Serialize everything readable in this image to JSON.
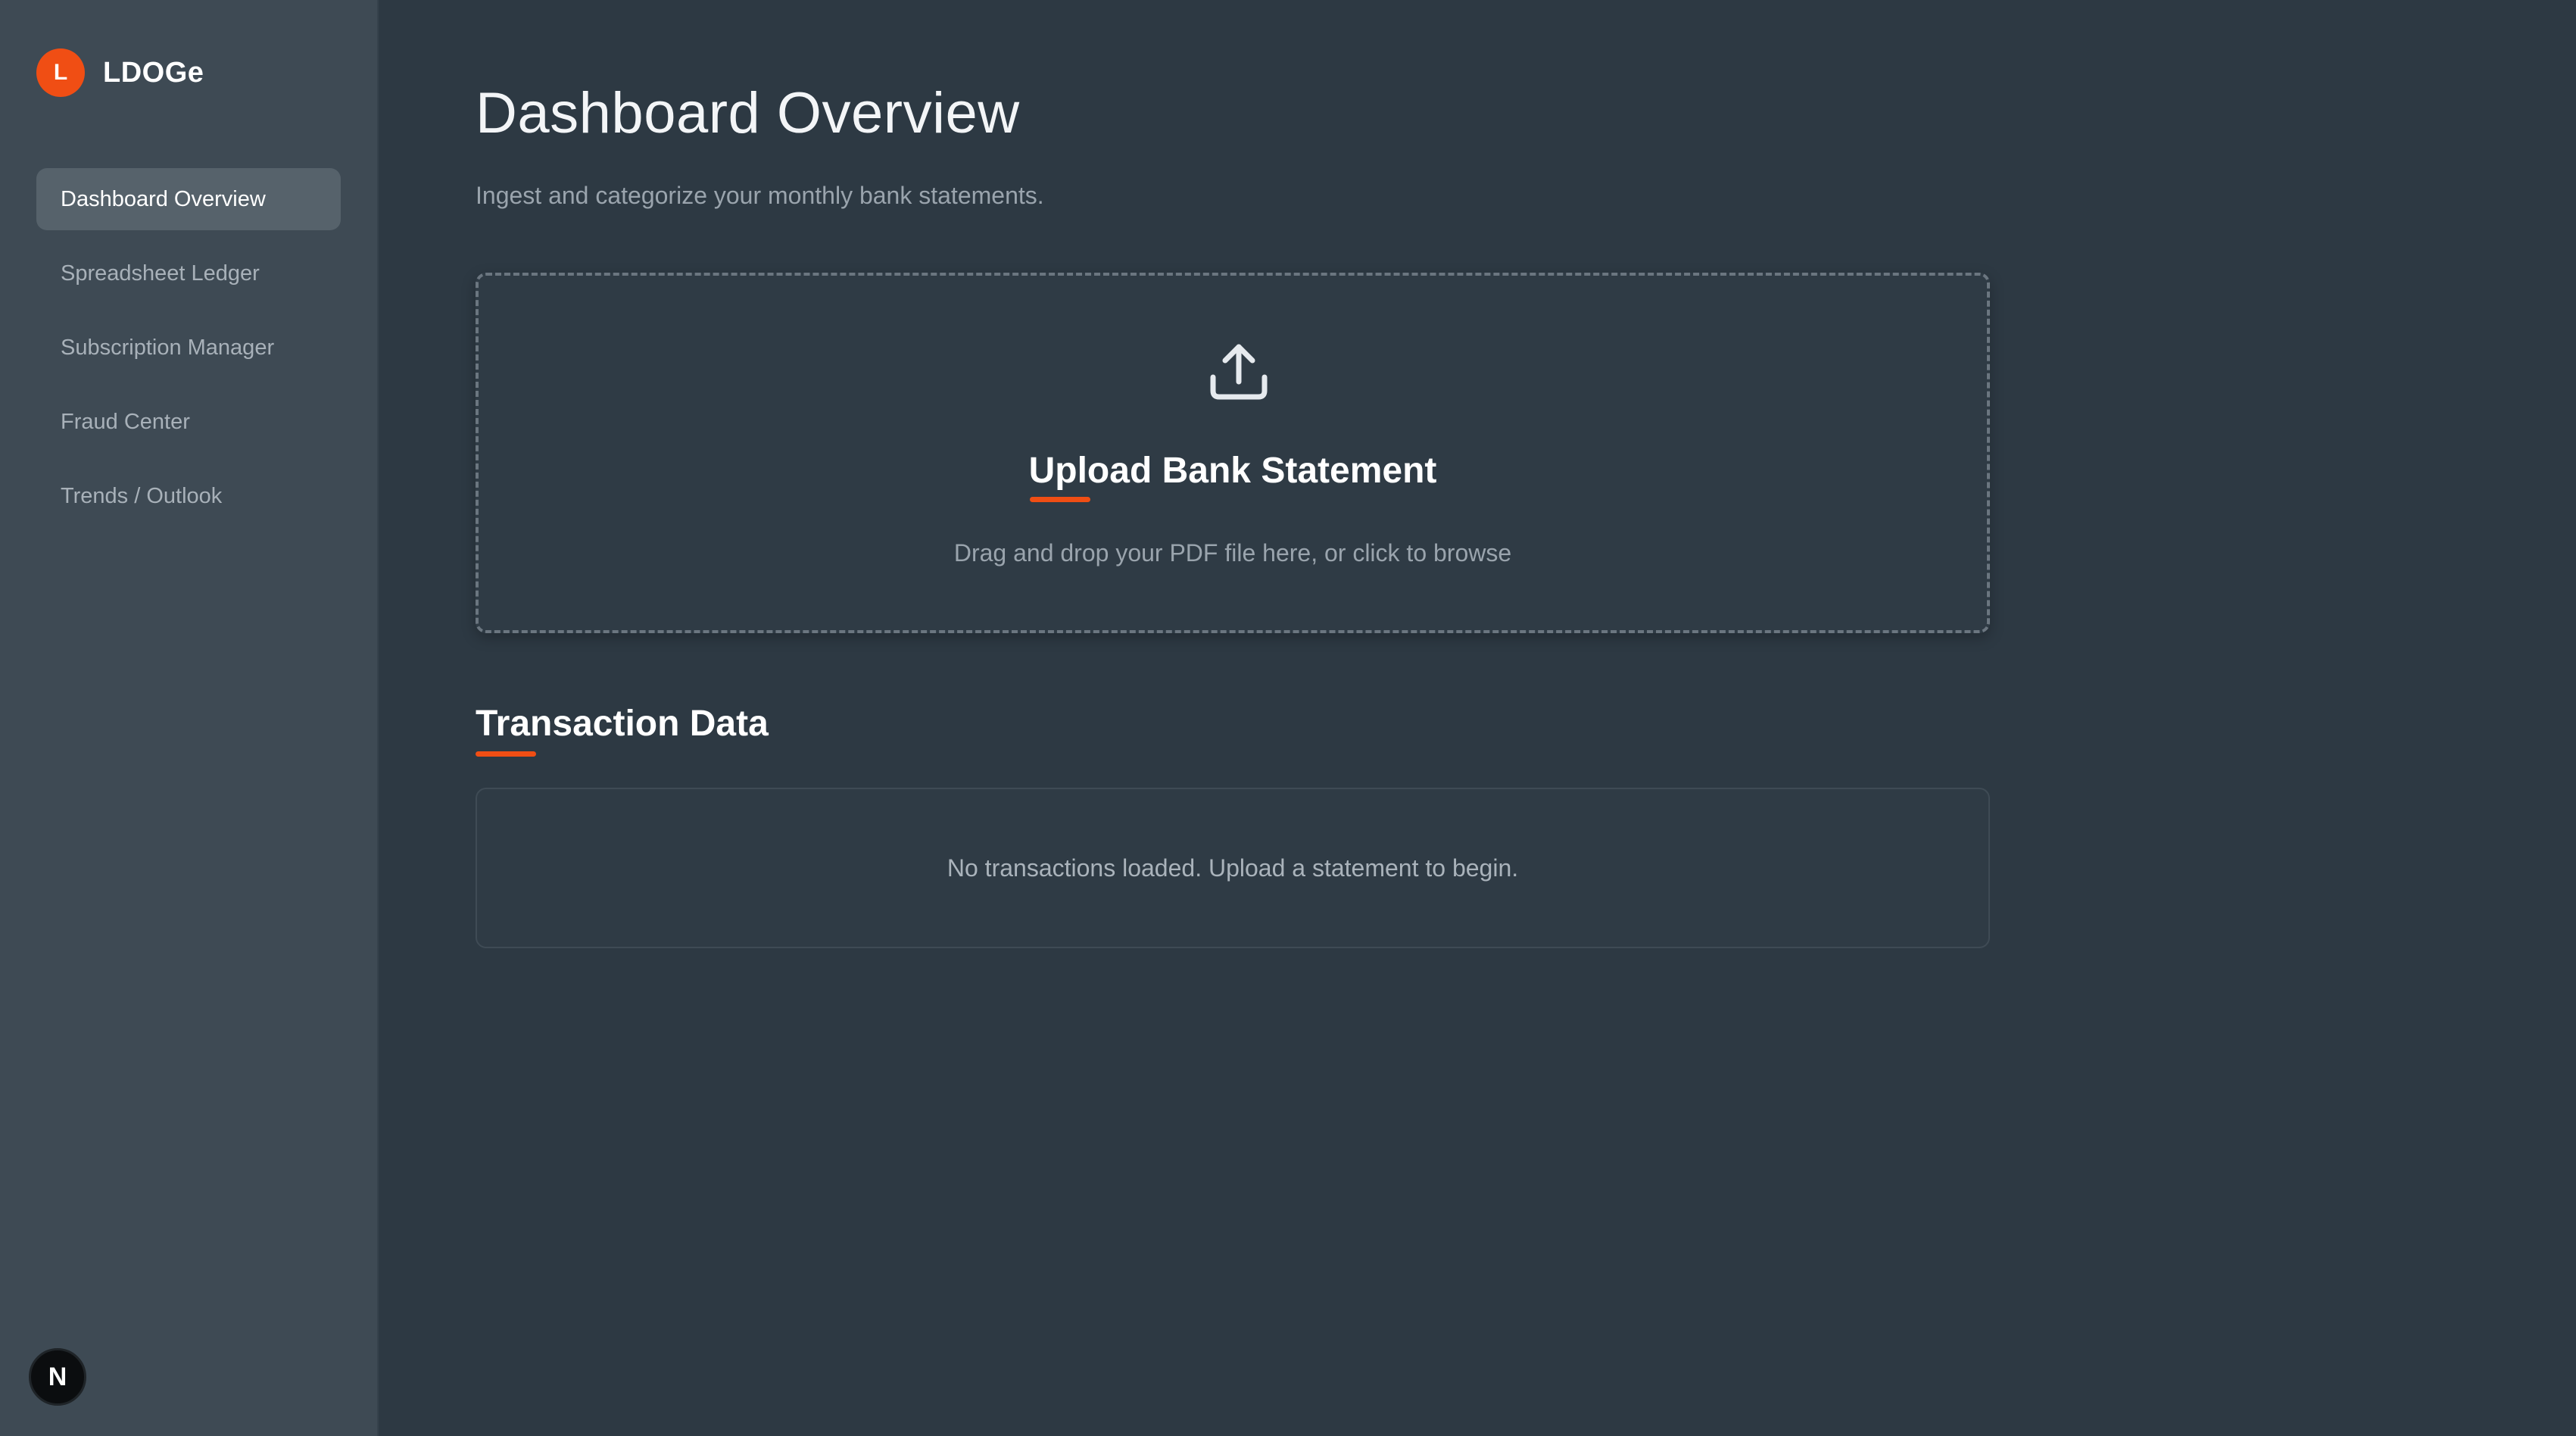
{
  "brand": {
    "logo_letter": "L",
    "name": "LDOGe"
  },
  "sidebar": {
    "items": [
      {
        "label": "Dashboard Overview",
        "active": true
      },
      {
        "label": "Spreadsheet Ledger",
        "active": false
      },
      {
        "label": "Subscription Manager",
        "active": false
      },
      {
        "label": "Fraud Center",
        "active": false
      },
      {
        "label": "Trends / Outlook",
        "active": false
      }
    ],
    "user_badge": "N"
  },
  "header": {
    "title": "Dashboard Overview",
    "subtitle": "Ingest and categorize your monthly bank statements."
  },
  "upload": {
    "icon": "upload-icon",
    "title": "Upload Bank Statement",
    "hint": "Drag and drop your PDF file here, or click to browse"
  },
  "transactions": {
    "title": "Transaction Data",
    "empty_message": "No transactions loaded. Upload a statement to begin."
  },
  "colors": {
    "accent": "#f04e14",
    "background": "#2d3943",
    "sidebar": "#3e4a54",
    "active_item": "#56626b"
  }
}
